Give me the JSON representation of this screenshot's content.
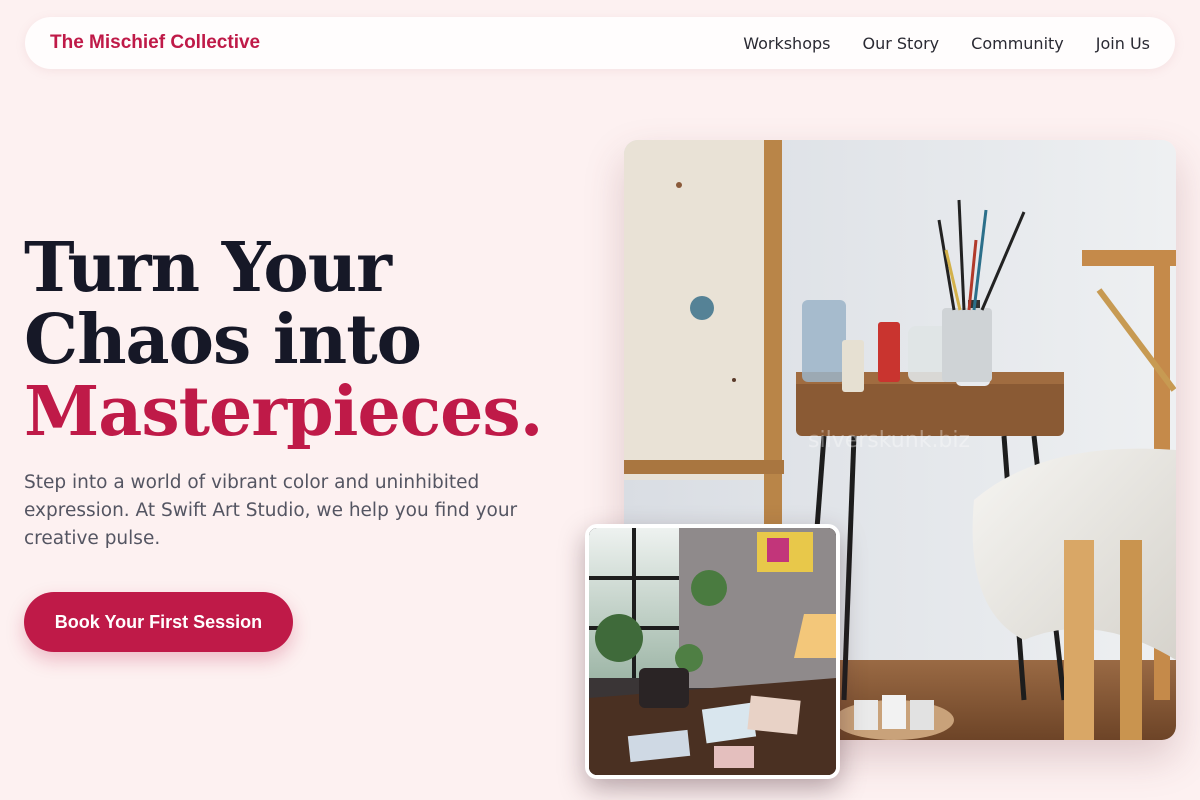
{
  "nav": {
    "brand": "The Mischief Collective",
    "links": [
      {
        "label": "Workshops"
      },
      {
        "label": "Our Story"
      },
      {
        "label": "Community"
      },
      {
        "label": "Join Us"
      }
    ]
  },
  "hero": {
    "title_line1": "Turn Your",
    "title_line2": "Chaos into",
    "title_accent": "Masterpieces.",
    "description": "Step into a world of vibrant color and uninhibited expression. At Swift Art Studio, we help you find your creative pulse.",
    "cta_label": "Book Your First Session"
  },
  "images": {
    "watermark_text": "silverskunk.biz"
  },
  "colors": {
    "background": "#fdf1f1",
    "accent": "#bf1a48",
    "heading": "#161827",
    "body_text": "#545562"
  }
}
